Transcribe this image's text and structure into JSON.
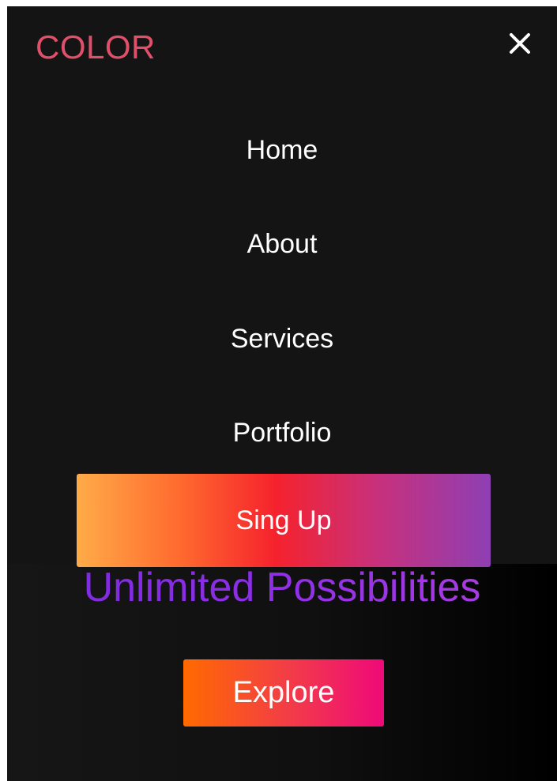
{
  "brand": {
    "logo_text": "COLOR"
  },
  "menu": {
    "close_icon": "close-icon",
    "items": [
      {
        "label": "Home"
      },
      {
        "label": "About"
      },
      {
        "label": "Services"
      },
      {
        "label": "Portfolio"
      }
    ],
    "signup_label": "Sing Up"
  },
  "hero": {
    "title": "Unlimited Possibilities",
    "explore_label": "Explore"
  },
  "colors": {
    "background": "#141414",
    "logo": "#e0506a",
    "hero_title": "#8a2be2",
    "signup_gradient": [
      "#ffab48",
      "#f5222d",
      "#8e3fb4"
    ],
    "explore_gradient": [
      "#ff6a00",
      "#ee0979"
    ]
  }
}
